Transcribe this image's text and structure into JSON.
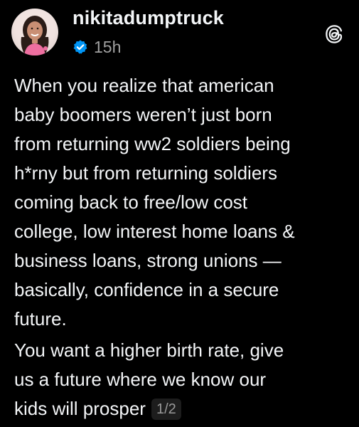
{
  "post": {
    "username": "nikitadumptruck",
    "timestamp": "15h",
    "verified_icon": "verified-badge-icon",
    "app_icon": "threads-logo-icon",
    "paragraph1_lines": [
      "When you realize that american",
      "baby boomers weren’t just born",
      "from returning ww2 soldiers being",
      "h*rny but from returning soldiers",
      "coming back to free/low cost",
      "college, low interest home loans &",
      "business loans, strong unions —",
      "basically, confidence in a secure",
      "future."
    ],
    "paragraph2_lines": [
      "You want a higher birth rate, give",
      "us a future where we know our",
      "kids will prosper"
    ],
    "pager": "1/2"
  },
  "colors": {
    "background": "#000000",
    "text": "#f3f5f7",
    "muted": "#a0a0a0",
    "verified": "#0095f6"
  }
}
